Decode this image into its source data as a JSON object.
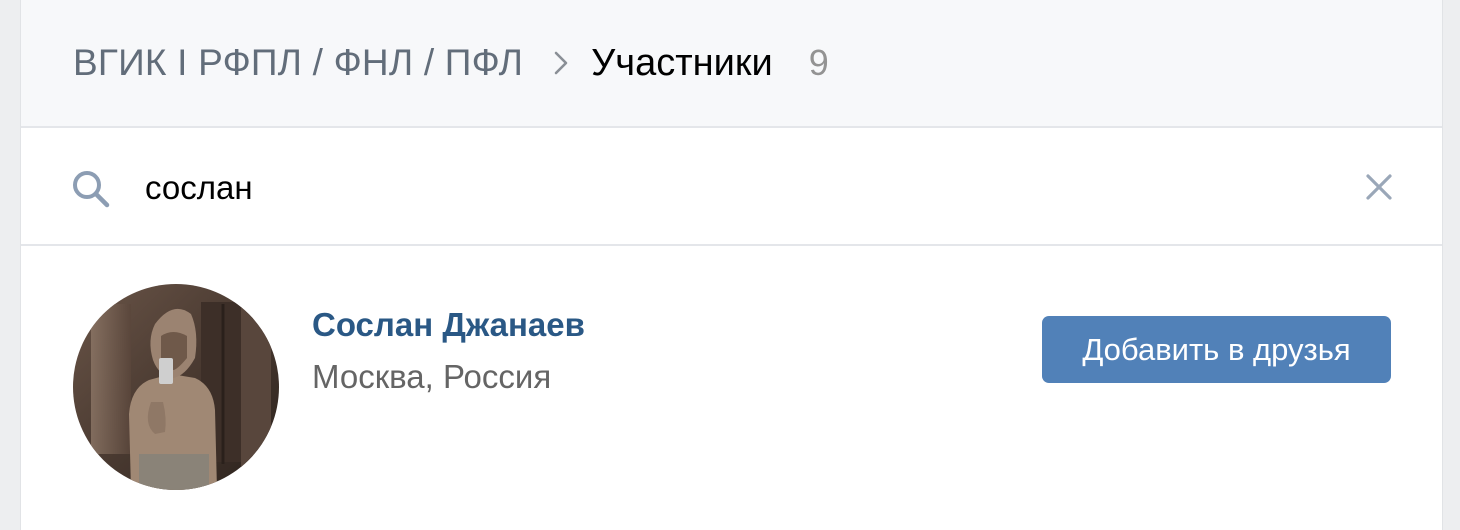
{
  "header": {
    "group_name": "ВГИК I РФПЛ / ФНЛ / ПФЛ",
    "section_title": "Участники",
    "member_count": "9"
  },
  "search": {
    "query": "сослан"
  },
  "results": [
    {
      "name": "Сослан Джанаев",
      "location": "Москва, Россия",
      "action_label": "Добавить в друзья"
    }
  ],
  "icons": {
    "breadcrumb_separator": "chevron-right-icon",
    "search": "search-icon",
    "clear": "close-icon"
  },
  "colors": {
    "accent": "#5181b8",
    "link": "#2a5885",
    "header_bg": "#f7f8fa",
    "muted_text": "#626d7a"
  }
}
